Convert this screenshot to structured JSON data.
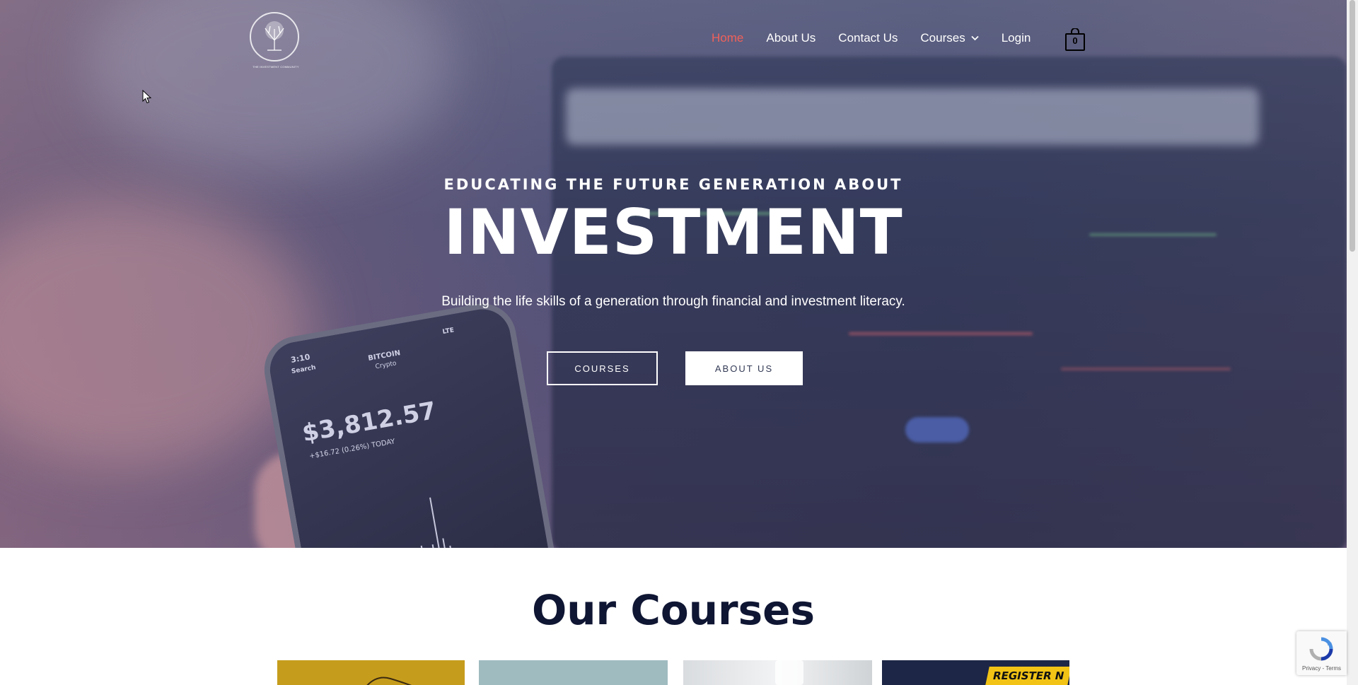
{
  "header": {
    "logo_icon": "tree-icon",
    "logo_caption": "THE INVESTMENT COMMUNITY",
    "nav": [
      {
        "label": "Home",
        "active": true
      },
      {
        "label": "About Us"
      },
      {
        "label": "Contact Us"
      },
      {
        "label": "Courses",
        "has_dropdown": true,
        "icon": "chevron-down-icon"
      },
      {
        "label": "Login"
      }
    ],
    "cart": {
      "icon": "shopping-bag-icon",
      "count": "0"
    }
  },
  "hero": {
    "kicker": "EDUCATING THE FUTURE GENERATION ABOUT",
    "title": "INVESTMENT",
    "subtitle": "Building the life skills of a generation through financial and investment literacy.",
    "buttons": [
      {
        "label": "COURSES"
      },
      {
        "label": "ABOUT US"
      }
    ],
    "phone_screen": {
      "time": "3:10",
      "back": "Search",
      "coin": "BITCOIN",
      "coin_sub": "Crypto",
      "price": "$3,812.57",
      "change": "+$16.72 (0.26%) TODAY",
      "network": "LTE"
    }
  },
  "courses": {
    "title": "Our Courses",
    "cards": [
      {
        "label": ""
      },
      {
        "label": ""
      },
      {
        "label": ""
      },
      {
        "label": "REGISTER N"
      }
    ]
  },
  "recaptcha": {
    "icon": "recaptcha-icon",
    "links": "Privacy - Terms"
  },
  "colors": {
    "nav_active": "#f0605a",
    "heading_dark": "#0f1633",
    "register_yellow": "#f2c315"
  }
}
